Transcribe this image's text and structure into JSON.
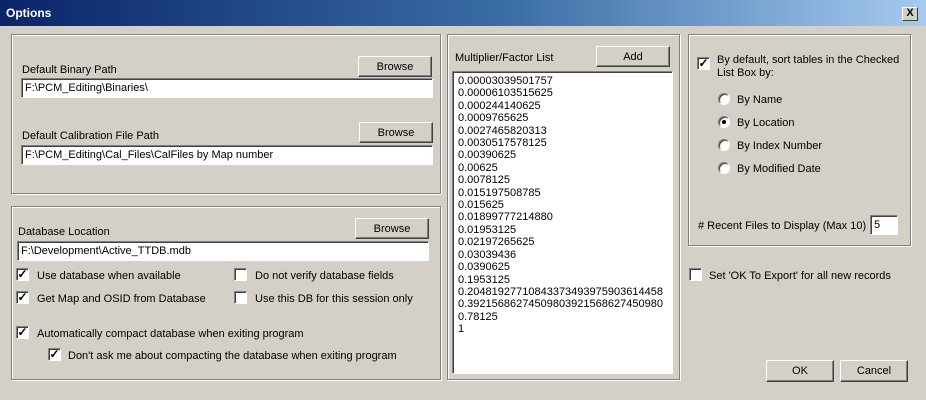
{
  "window": {
    "title": "Options",
    "close_label": "X"
  },
  "paths": {
    "binary_label": "Default Binary Path",
    "binary_value": "F:\\PCM_Editing\\Binaries\\",
    "calibration_label": "Default Calibration File Path",
    "calibration_value": "F:\\PCM_Editing\\Cal_Files\\CalFiles by Map number",
    "browse_label": "Browse"
  },
  "database": {
    "location_label": "Database Location",
    "location_value": "F:\\Development\\Active_TTDB.mdb",
    "browse_label": "Browse",
    "options": {
      "use_db": {
        "label": "Use database when available",
        "checked": true
      },
      "no_verify": {
        "label": "Do not verify database fields",
        "checked": false
      },
      "get_map": {
        "label": "Get Map and OSID from Database",
        "checked": true
      },
      "session_only": {
        "label": "Use this DB for this session only",
        "checked": false
      },
      "auto_compact": {
        "label": "Automatically compact database when exiting program",
        "checked": true
      },
      "dont_ask": {
        "label": "Don't ask me about compacting the database when exiting program",
        "checked": true
      }
    }
  },
  "multiplier": {
    "label": "Multiplier/Factor List",
    "add_label": "Add",
    "items": [
      "0.00003039501757",
      "0.00006103515625",
      "0.000244140625",
      "0.0009765625",
      "0.0027465820313",
      "0.0030517578125",
      "0.00390625",
      "0.00625",
      "0.0078125",
      "0.015197508785",
      "0.015625",
      "0.01899777214880",
      "0.01953125",
      "0.02197265625",
      "0.03039436",
      "0.0390625",
      "0.1953125",
      "0.20481927710843373493975903614458",
      "0.39215686274509803921568627450980",
      "0.78125",
      "1"
    ]
  },
  "sorting": {
    "checkbox_label": "By default, sort tables in the Checked List Box by:",
    "checked": true,
    "options": [
      {
        "label": "By Name",
        "selected": false
      },
      {
        "label": "By Location",
        "selected": true
      },
      {
        "label": "By Index Number",
        "selected": false
      },
      {
        "label": "By Modified Date",
        "selected": false
      }
    ],
    "recent_label": "# Recent Files to Display (Max 10)",
    "recent_value": "5"
  },
  "export": {
    "label": "Set 'OK To Export' for all new records",
    "checked": false
  },
  "buttons": {
    "ok": "OK",
    "cancel": "Cancel"
  }
}
